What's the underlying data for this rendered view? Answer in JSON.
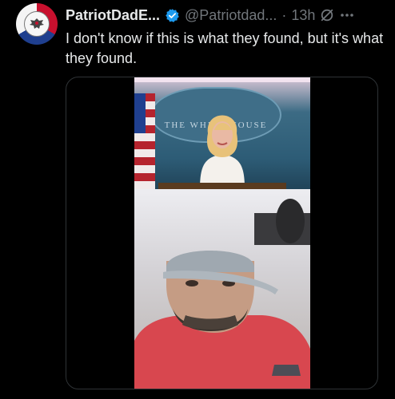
{
  "tweet": {
    "display_name": "PatriotDadE...",
    "handle": "@Patriotdad...",
    "separator": "·",
    "time": "13h",
    "text": "I don't know if this is what they found, but it's what they found."
  },
  "icons": {
    "avatar": "eagle-emblem-avatar",
    "verified": "verified-badge-icon",
    "grok": "grok-icon",
    "more": "more-options-icon"
  },
  "media": {
    "seal_text": "THE WHITE HOUSE"
  },
  "colors": {
    "verified_blue": "#1d9bf0",
    "muted": "#71767b",
    "text": "#e7e9ea",
    "border": "#2f3336"
  }
}
